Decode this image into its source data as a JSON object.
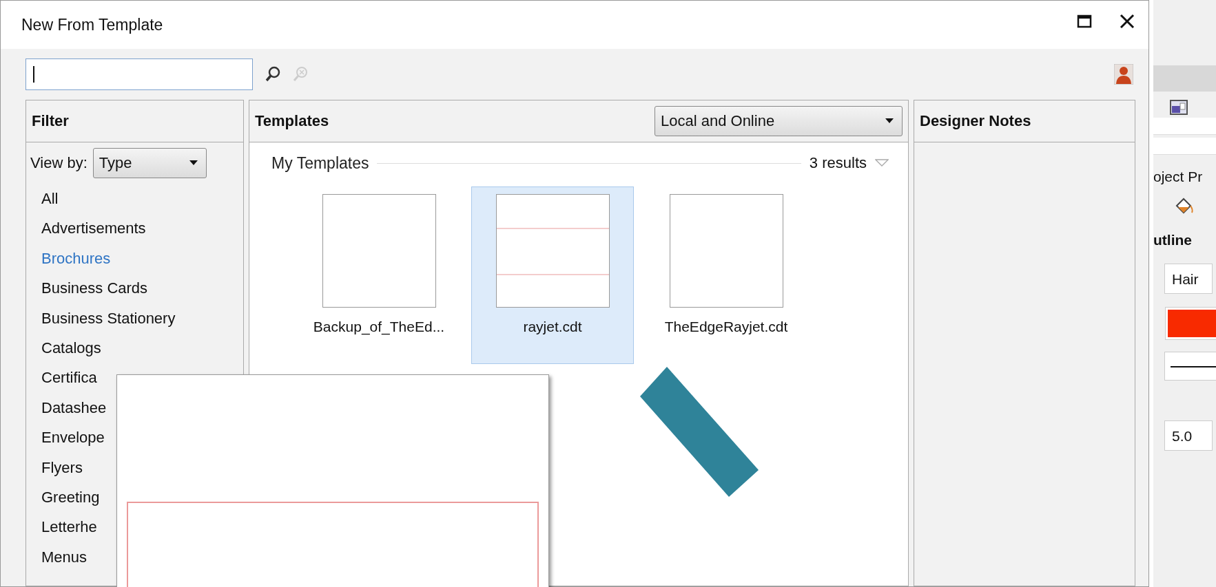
{
  "window": {
    "title": "New From Template"
  },
  "filter": {
    "title": "Filter",
    "view_by_label": "View by:",
    "view_by_value": "Type",
    "categories": [
      {
        "label": "All",
        "selected": false
      },
      {
        "label": "Advertisements",
        "selected": false
      },
      {
        "label": "Brochures",
        "selected": true
      },
      {
        "label": "Business Cards",
        "selected": false
      },
      {
        "label": "Business Stationery",
        "selected": false
      },
      {
        "label": "Catalogs",
        "selected": false
      },
      {
        "label": "Certifica",
        "selected": false
      },
      {
        "label": "Datashee",
        "selected": false
      },
      {
        "label": "Envelope",
        "selected": false
      },
      {
        "label": "Flyers",
        "selected": false
      },
      {
        "label": "Greeting",
        "selected": false
      },
      {
        "label": "Letterhe",
        "selected": false
      },
      {
        "label": "Menus",
        "selected": false
      }
    ]
  },
  "templates": {
    "title": "Templates",
    "source": "Local and Online",
    "group": "My Templates",
    "results": "3 results",
    "items": [
      {
        "name": "Backup_of_TheEd...",
        "selected": false,
        "kind": "blank"
      },
      {
        "name": "rayjet.cdt",
        "selected": true,
        "kind": "lined"
      },
      {
        "name": "TheEdgeRayjet.cdt",
        "selected": false,
        "kind": "blank"
      }
    ]
  },
  "designer_notes": {
    "title": "Designer Notes"
  },
  "background_app": {
    "section": "oject Pr",
    "heading": "utline",
    "width_value": "Hair",
    "size_value": "5.0"
  }
}
